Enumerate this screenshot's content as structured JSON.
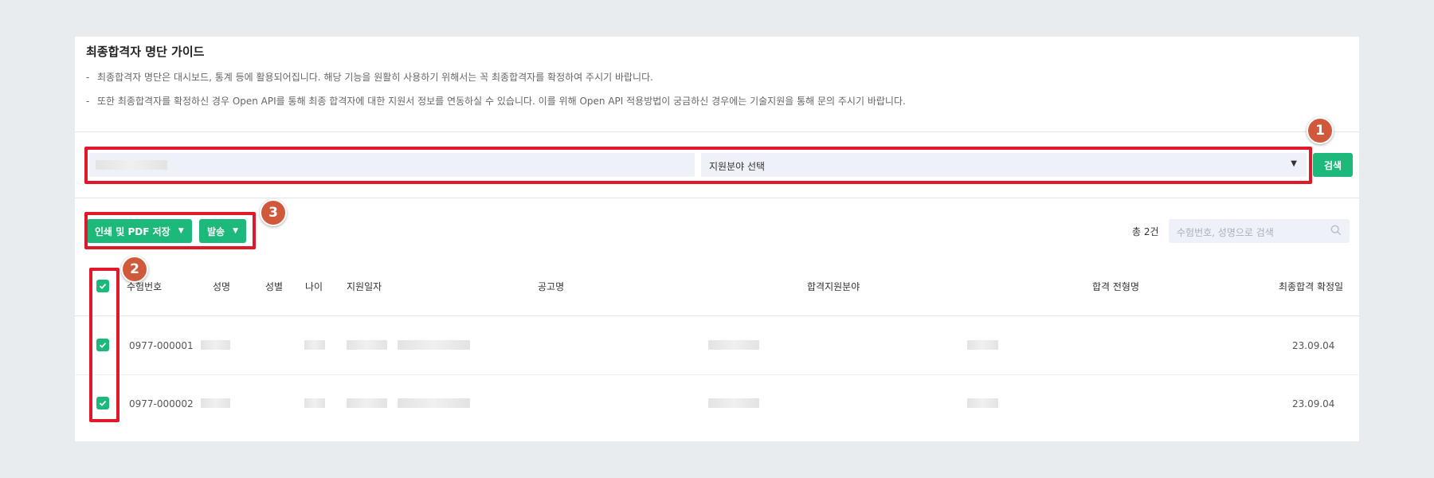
{
  "guide": {
    "title": "최종합격자 명단 가이드",
    "dash": "-",
    "lines": [
      "최종합격자 명단은 대시보드, 통계 등에 활용되어집니다. 해당 기능을 원활히 사용하기 위해서는 꼭 최종합격자를 확정하여 주시기 바랍니다.",
      "또한 최종합격자를 확정하신 경우 Open API를 통해 최종 합격자에 대한 지원서 정보를 연동하실 수 있습니다. 이를 위해 Open API 적용방법이 궁금하신 경우에는 기술지원을 통해 문의 주시기 바랍니다."
    ]
  },
  "filters": {
    "field_select_value": "지원분야 선택",
    "search_button": "검색"
  },
  "actions": {
    "print_pdf": "인쇄 및 PDF 저장",
    "send": "발송"
  },
  "summary": {
    "total": "총 2건",
    "search_placeholder": "수험번호, 성명으로 검색"
  },
  "table": {
    "headers": {
      "exam_no": "수험번호",
      "name": "성명",
      "gender": "성별",
      "age": "나이",
      "apply_date": "지원일자",
      "posting": "공고명",
      "field": "합격지원분야",
      "stage": "합격 전형명",
      "final_date": "최종합격 확정일"
    },
    "rows": [
      {
        "exam_no": "0977-000001",
        "final_date": "23.09.04",
        "checked": true
      },
      {
        "exam_no": "0977-000002",
        "final_date": "23.09.04",
        "checked": true
      }
    ]
  },
  "annotations": {
    "b1": "1",
    "b2": "2",
    "b3": "3"
  },
  "colors": {
    "accent": "#1db97a",
    "highlight": "#e0182a",
    "badge": "#d0593c"
  }
}
